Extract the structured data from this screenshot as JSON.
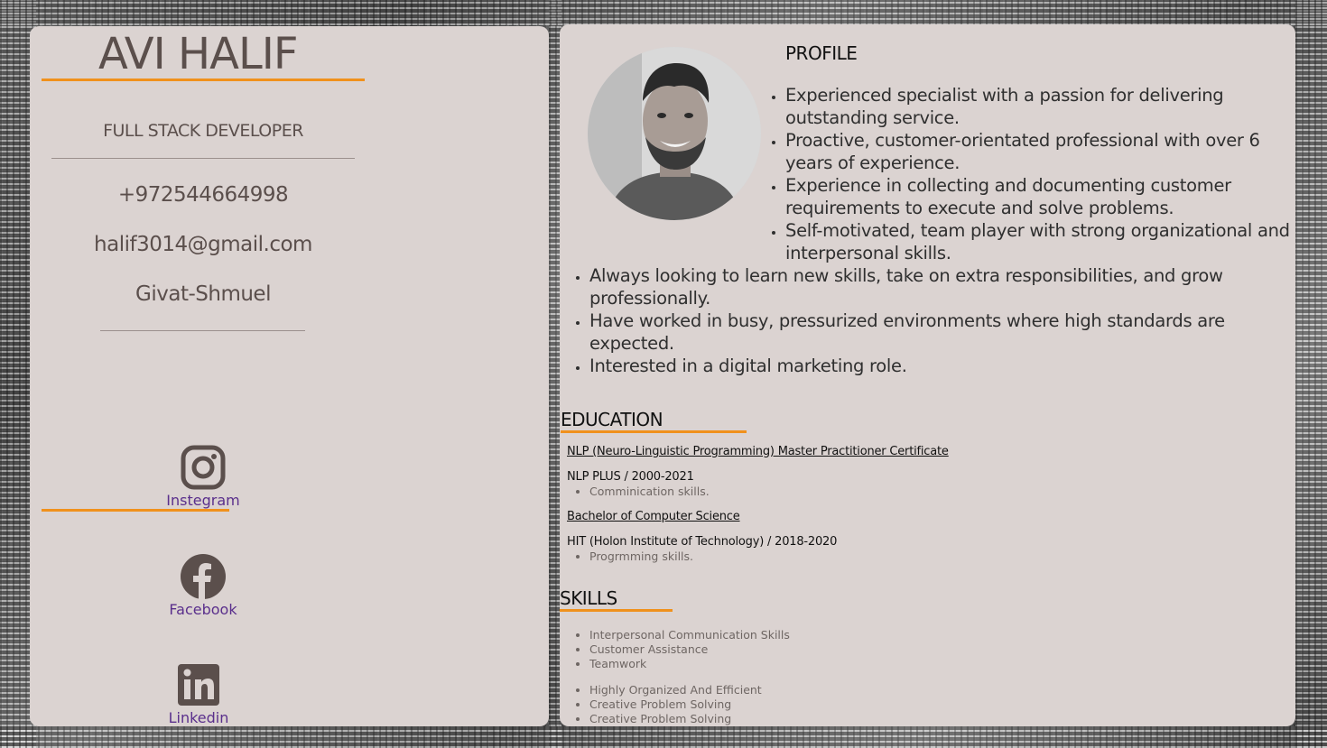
{
  "header": {
    "name": "AVI HALIF",
    "role": "FULL STACK DEVELOPER"
  },
  "contact": {
    "phone": "+972544664998",
    "email": "halif3014@gmail.com",
    "location": "Givat-Shmuel"
  },
  "social": [
    {
      "label": "Instegram",
      "icon": "instagram-icon"
    },
    {
      "label": "Facebook",
      "icon": "facebook-icon"
    },
    {
      "label": "Linkedin",
      "icon": "linkedin-icon"
    }
  ],
  "profile": {
    "title": "PROFILE",
    "items": [
      "Experienced specialist with a passion for delivering outstanding service.",
      "Proactive, customer-orientated professional with over 6 years of experience.",
      "Experience in collecting and documenting customer requirements to execute and solve problems.",
      "Self-motivated, team player with strong organizational and interpersonal skills.",
      "Always looking to learn new skills, take on extra responsibilities, and grow professionally.",
      "Have worked in busy, pressurized environments where high standards are expected.",
      "Interested in a digital marketing role."
    ]
  },
  "education": {
    "title": "EDUCATION",
    "entries": [
      {
        "link": "NLP (Neuro-Linguistic Programming) Master Practitioner Certificate",
        "org": "NLP PLUS / 2000-2021",
        "details": [
          "Comminication skills."
        ]
      },
      {
        "link": "Bachelor of Computer Science",
        "org": "HIT (Holon Institute of Technology) / 2018-2020",
        "details": [
          "Progrmming skills."
        ]
      }
    ]
  },
  "skills": {
    "title": "SKILLS",
    "group1": [
      "Interpersonal Communication Skills",
      "Customer Assistance",
      "Teamwork"
    ],
    "group2": [
      "Highly Organized And Efficient",
      "Creative Problem Solving",
      "Creative Problem Solving"
    ]
  },
  "colors": {
    "card": "#dbd3d1",
    "accent": "#f0911c",
    "text": "#5b4f4c",
    "link": "#5a2f8c"
  }
}
